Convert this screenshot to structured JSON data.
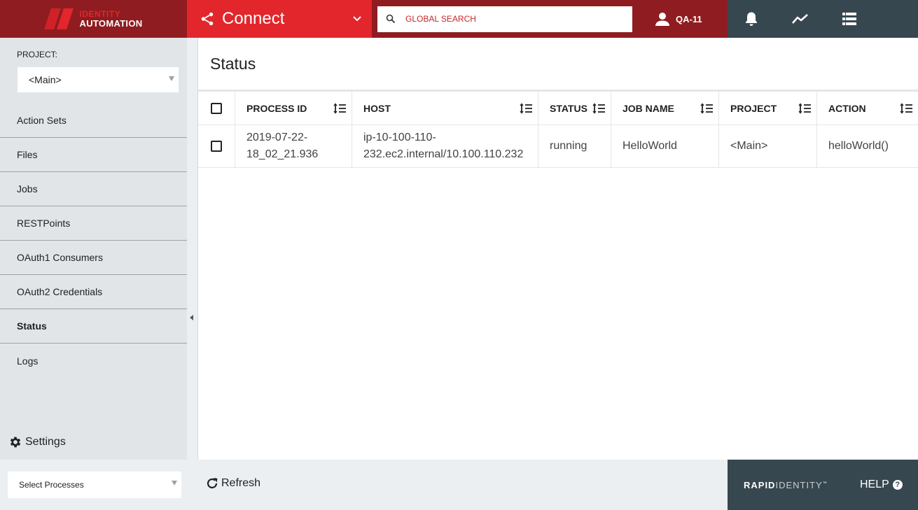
{
  "brand": {
    "line1": "IDENTITY",
    "line2": "AUTOMATION"
  },
  "header": {
    "module_title": "Connect",
    "search_placeholder": "GLOBAL SEARCH",
    "user_name": "QA-11",
    "icons": [
      "share-icon",
      "chevron-down-icon",
      "search-icon",
      "user-icon",
      "bell-icon",
      "activity-icon",
      "list-icon"
    ]
  },
  "sidebar": {
    "project_label": "PROJECT:",
    "project_value": "<Main>",
    "items": [
      {
        "label": "Action Sets",
        "active": false
      },
      {
        "label": "Files",
        "active": false
      },
      {
        "label": "Jobs",
        "active": false
      },
      {
        "label": "RESTPoints",
        "active": false
      },
      {
        "label": "OAuth1 Consumers",
        "active": false
      },
      {
        "label": "OAuth2 Credentials",
        "active": false
      },
      {
        "label": "Status",
        "active": true
      },
      {
        "label": "Logs",
        "active": false
      }
    ],
    "settings_label": "Settings"
  },
  "main": {
    "title": "Status",
    "table": {
      "columns": [
        "PROCESS ID",
        "HOST",
        "STATUS",
        "JOB NAME",
        "PROJECT",
        "ACTION"
      ],
      "rows": [
        {
          "process_id_line1": "2019-07-22-",
          "process_id_line2": "18_02_21.936",
          "host_line1": "ip-10-100-110-",
          "host_line2": "232.ec2.internal/10.100.110.232",
          "status": "running",
          "job_name": "HelloWorld",
          "project": "<Main>",
          "action": "helloWorld()"
        }
      ]
    }
  },
  "footer": {
    "process_select": "Select Processes",
    "refresh_label": "Refresh",
    "logo_bold": "RAPID",
    "logo_light": "IDENTITY",
    "logo_tm": "™",
    "help_label": "HELP",
    "help_icon": "?"
  },
  "colors": {
    "brand_dark_red": "#8f1c20",
    "brand_red": "#e2262c",
    "slate": "#37474f",
    "sidebar_bg": "#e1e5e8"
  }
}
